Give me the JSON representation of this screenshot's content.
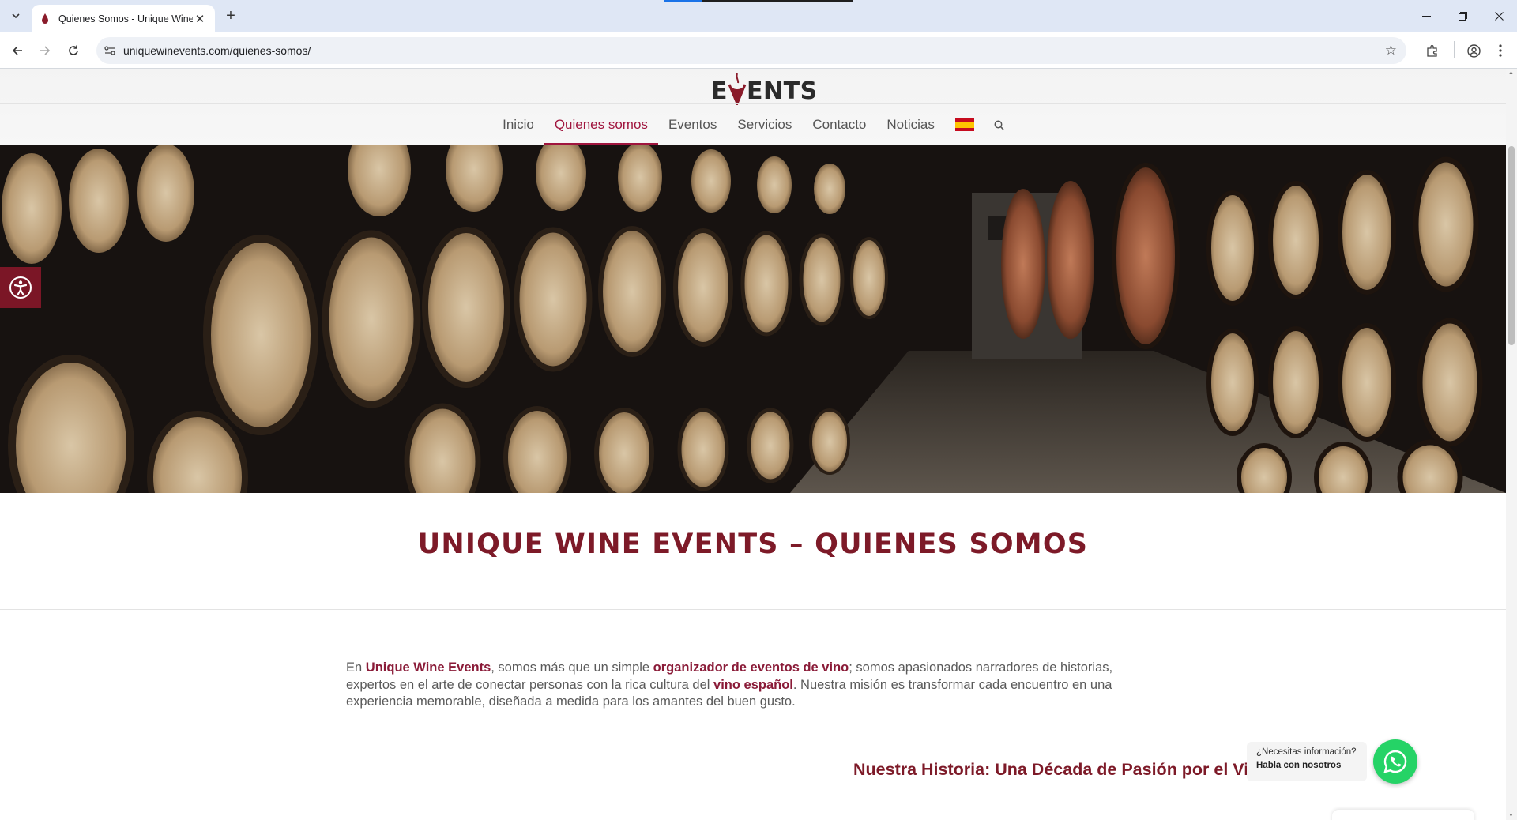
{
  "browser": {
    "tab_title": "Quienes Somos - Unique Wine",
    "url": "uniquewinevents.com/quienes-somos/"
  },
  "site": {
    "logo_prefix": "E",
    "logo_suffix": "ENTS",
    "nav": [
      {
        "label": "Inicio",
        "active": false
      },
      {
        "label": "Quienes somos",
        "active": true
      },
      {
        "label": "Eventos",
        "active": false
      },
      {
        "label": "Servicios",
        "active": false
      },
      {
        "label": "Contacto",
        "active": false
      },
      {
        "label": "Noticias",
        "active": false
      }
    ],
    "language_flag": "spain-flag-icon",
    "colors": {
      "accent": "#a0153e",
      "title": "#7d1a28",
      "accessibility_button": "#7b1626",
      "whatsapp": "#25d366"
    }
  },
  "hero": {
    "image_icon": "wine-barrels-cellar-photo"
  },
  "content": {
    "page_title": "UNIQUE WINE EVENTS – QUIENES SOMOS",
    "intro": {
      "t1": "En ",
      "h1": "Unique Wine Events",
      "t2": ", somos más que un simple ",
      "h2": "organizador de eventos de vino",
      "t3": "; somos apasionados narradores de historias, expertos en el arte de conectar personas con la rica cultura del ",
      "h3": "vino español",
      "t4": ". Nuestra misión es transformar cada encuentro en una experiencia memorable, diseñada a medida para los amantes del buen gusto."
    },
    "section_heading": "Nuestra Historia: Una Década de Pasión por el Vino"
  },
  "whatsapp": {
    "line1": "¿Necesitas información?",
    "line2": "Habla con nosotros"
  }
}
